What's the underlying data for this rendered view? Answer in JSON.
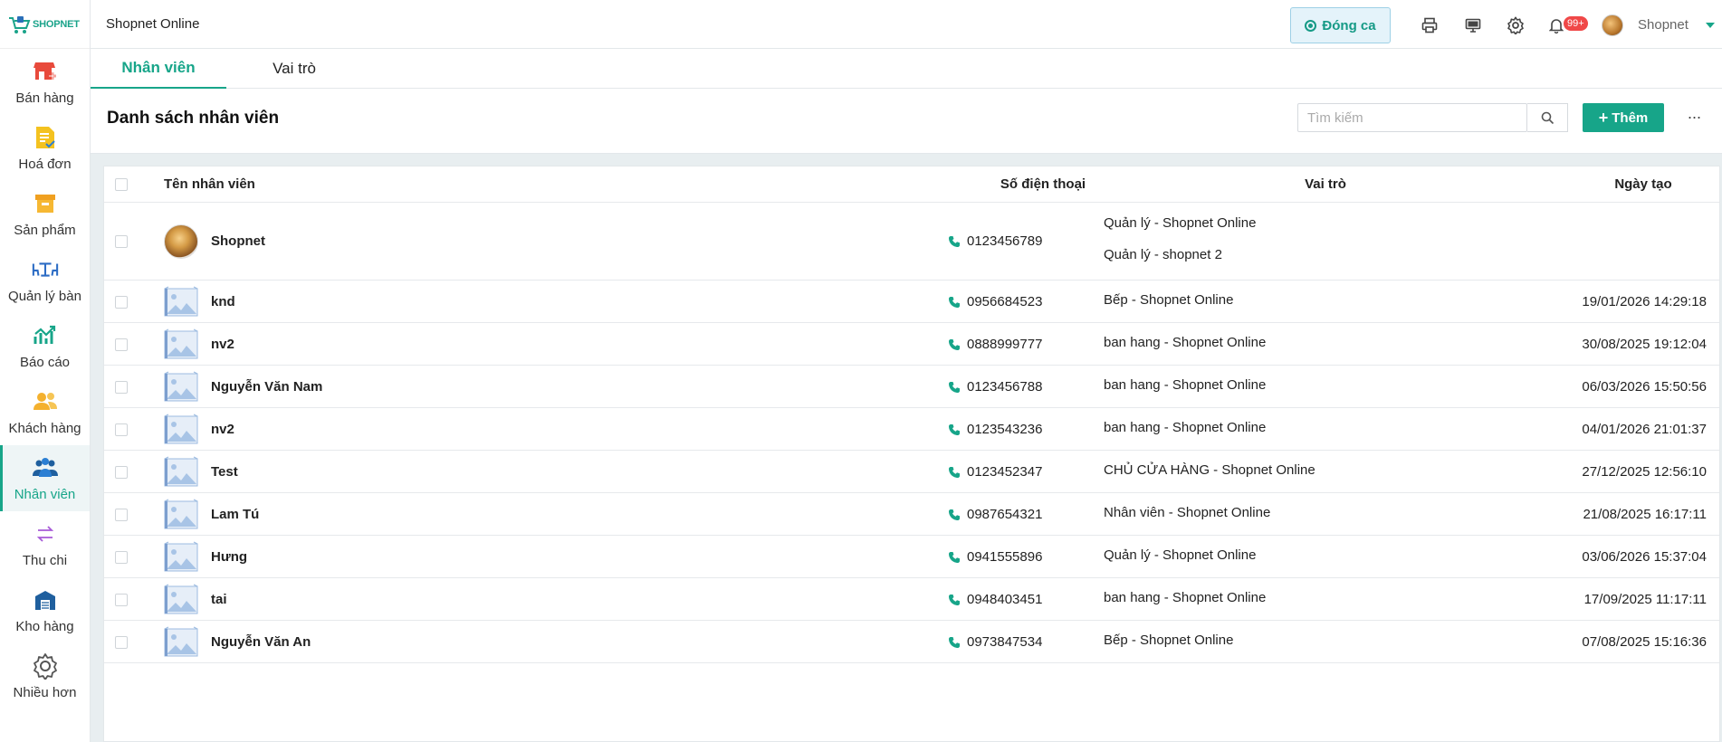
{
  "brand": {
    "logo_text": "SHOPNET",
    "accent": "#17a589"
  },
  "sidebar": {
    "items": [
      {
        "label": "Bán hàng",
        "icon": "store-cart-icon",
        "active": false
      },
      {
        "label": "Hoá đơn",
        "icon": "invoice-icon",
        "active": false
      },
      {
        "label": "Sản phẩm",
        "icon": "product-box-icon",
        "active": false
      },
      {
        "label": "Quản lý bàn",
        "icon": "table-icon",
        "active": false
      },
      {
        "label": "Báo cáo",
        "icon": "report-chart-icon",
        "active": false
      },
      {
        "label": "Khách hàng",
        "icon": "customers-icon",
        "active": false
      },
      {
        "label": "Nhân viên",
        "icon": "staff-icon",
        "active": true
      },
      {
        "label": "Thu chi",
        "icon": "exchange-icon",
        "active": false
      },
      {
        "label": "Kho hàng",
        "icon": "warehouse-icon",
        "active": false
      },
      {
        "label": "Nhiều hơn",
        "icon": "gear-icon",
        "active": false
      }
    ]
  },
  "topbar": {
    "store_name": "Shopnet Online",
    "close_shift_label": "Đóng ca",
    "notification_count": "99+",
    "user_name": "Shopnet"
  },
  "tabs": [
    {
      "label": "Nhân viên",
      "active": true
    },
    {
      "label": "Vai trò",
      "active": false
    }
  ],
  "header": {
    "title": "Danh sách nhân viên",
    "search_placeholder": "Tìm kiếm",
    "add_label": "Thêm",
    "more_label": "···"
  },
  "table": {
    "columns": [
      "Tên nhân viên",
      "Số điện thoại",
      "Vai trò",
      "Ngày tạo"
    ],
    "rows": [
      {
        "name": "Shopnet",
        "phone": "0123456789",
        "roles": [
          "Quản lý - Shopnet Online",
          "Quản lý - shopnet 2"
        ],
        "created": "",
        "has_photo": true
      },
      {
        "name": "knd",
        "phone": "0956684523",
        "roles": [
          "Bếp - Shopnet Online"
        ],
        "created": "19/01/2026 14:29:18"
      },
      {
        "name": "nv2",
        "phone": "0888999777",
        "roles": [
          "ban hang - Shopnet Online"
        ],
        "created": "30/08/2025 19:12:04"
      },
      {
        "name": "Nguyễn Văn Nam",
        "phone": "0123456788",
        "roles": [
          "ban hang - Shopnet Online"
        ],
        "created": "06/03/2026 15:50:56"
      },
      {
        "name": "nv2",
        "phone": "0123543236",
        "roles": [
          "ban hang - Shopnet Online"
        ],
        "created": "04/01/2026 21:01:37"
      },
      {
        "name": "Test",
        "phone": "0123452347",
        "roles": [
          "CHỦ CỬA HÀNG - Shopnet Online"
        ],
        "created": "27/12/2025 12:56:10"
      },
      {
        "name": "Lam Tú",
        "phone": "0987654321",
        "roles": [
          "Nhân viên - Shopnet Online"
        ],
        "created": "21/08/2025 16:17:11"
      },
      {
        "name": "Hưng",
        "phone": "0941555896",
        "roles": [
          "Quản lý - Shopnet Online"
        ],
        "created": "03/06/2026 15:37:04"
      },
      {
        "name": "tai",
        "phone": "0948403451",
        "roles": [
          "ban hang - Shopnet Online"
        ],
        "created": "17/09/2025 11:17:11"
      },
      {
        "name": "Nguyễn Văn An",
        "phone": "0973847534",
        "roles": [
          "Bếp - Shopnet Online"
        ],
        "created": "07/08/2025 15:16:36"
      }
    ]
  }
}
